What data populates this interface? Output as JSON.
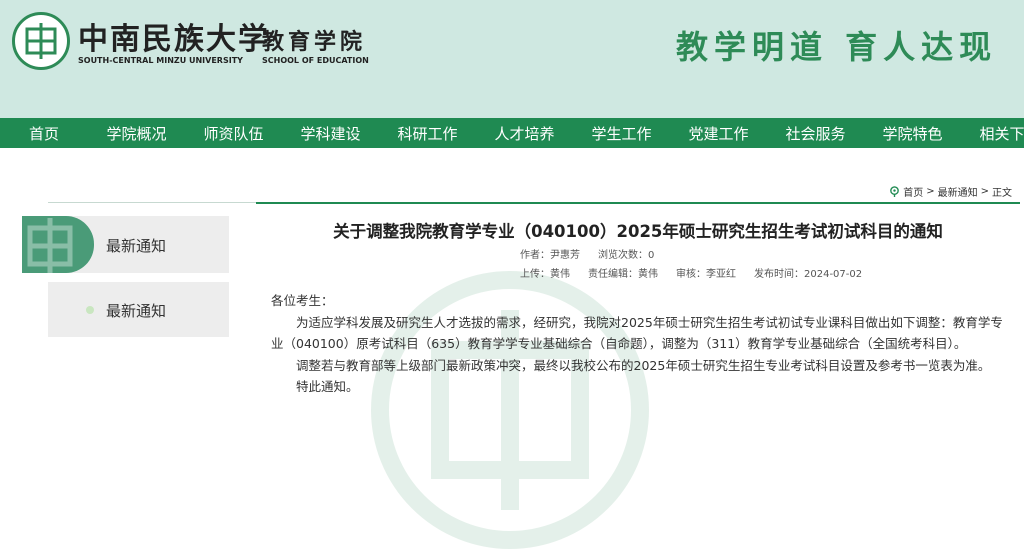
{
  "header": {
    "university_cn": "中南民族大学",
    "university_en": "SOUTH-CENTRAL MINZU UNIVERSITY",
    "school_cn": "教育学院",
    "school_en": "SCHOOL OF EDUCATION",
    "motto": "教学明道 育人达现"
  },
  "nav": {
    "items": [
      "首页",
      "学院概况",
      "师资队伍",
      "学科建设",
      "科研工作",
      "人才培养",
      "学生工作",
      "党建工作",
      "社会服务",
      "学院特色",
      "相关下载"
    ]
  },
  "breadcrumb": {
    "home": "首页",
    "sep1": ">",
    "section": "最新通知",
    "sep2": ">",
    "current": "正文"
  },
  "sidebar": {
    "active_label": "最新通知",
    "items": [
      {
        "label": "最新通知"
      }
    ]
  },
  "article": {
    "title": "关于调整我院教育学专业（040100）2025年硕士研究生招生考试初试科目的通知",
    "author": "作者：尹惠芳",
    "views": "浏览次数：0",
    "uploader": "上传：黄伟",
    "editor": "责任编辑：黄伟",
    "reviewer": "审核：李亚红",
    "date": "发布时间：2024-07-02",
    "greeting": "各位考生：",
    "para1": "为适应学科发展及研究生人才选拔的需求，经研究，我院对2025年硕士研究生招生考试初试专业课科目做出如下调整：教育学专业（040100）原考试科目（635）教育学学专业基础综合（自命题），调整为（311）教育学专业基础综合（全国统考科目）。",
    "para2": "调整若与教育部等上级部门最新政策冲突，最终以我校公布的2025年硕士研究生招生专业考试科目设置及参考书一览表为准。",
    "closing": "特此通知。"
  },
  "colors": {
    "nav_green": "#1f8a52",
    "header_bg": "#cfe8e1",
    "motto_green": "#2e8b57"
  }
}
